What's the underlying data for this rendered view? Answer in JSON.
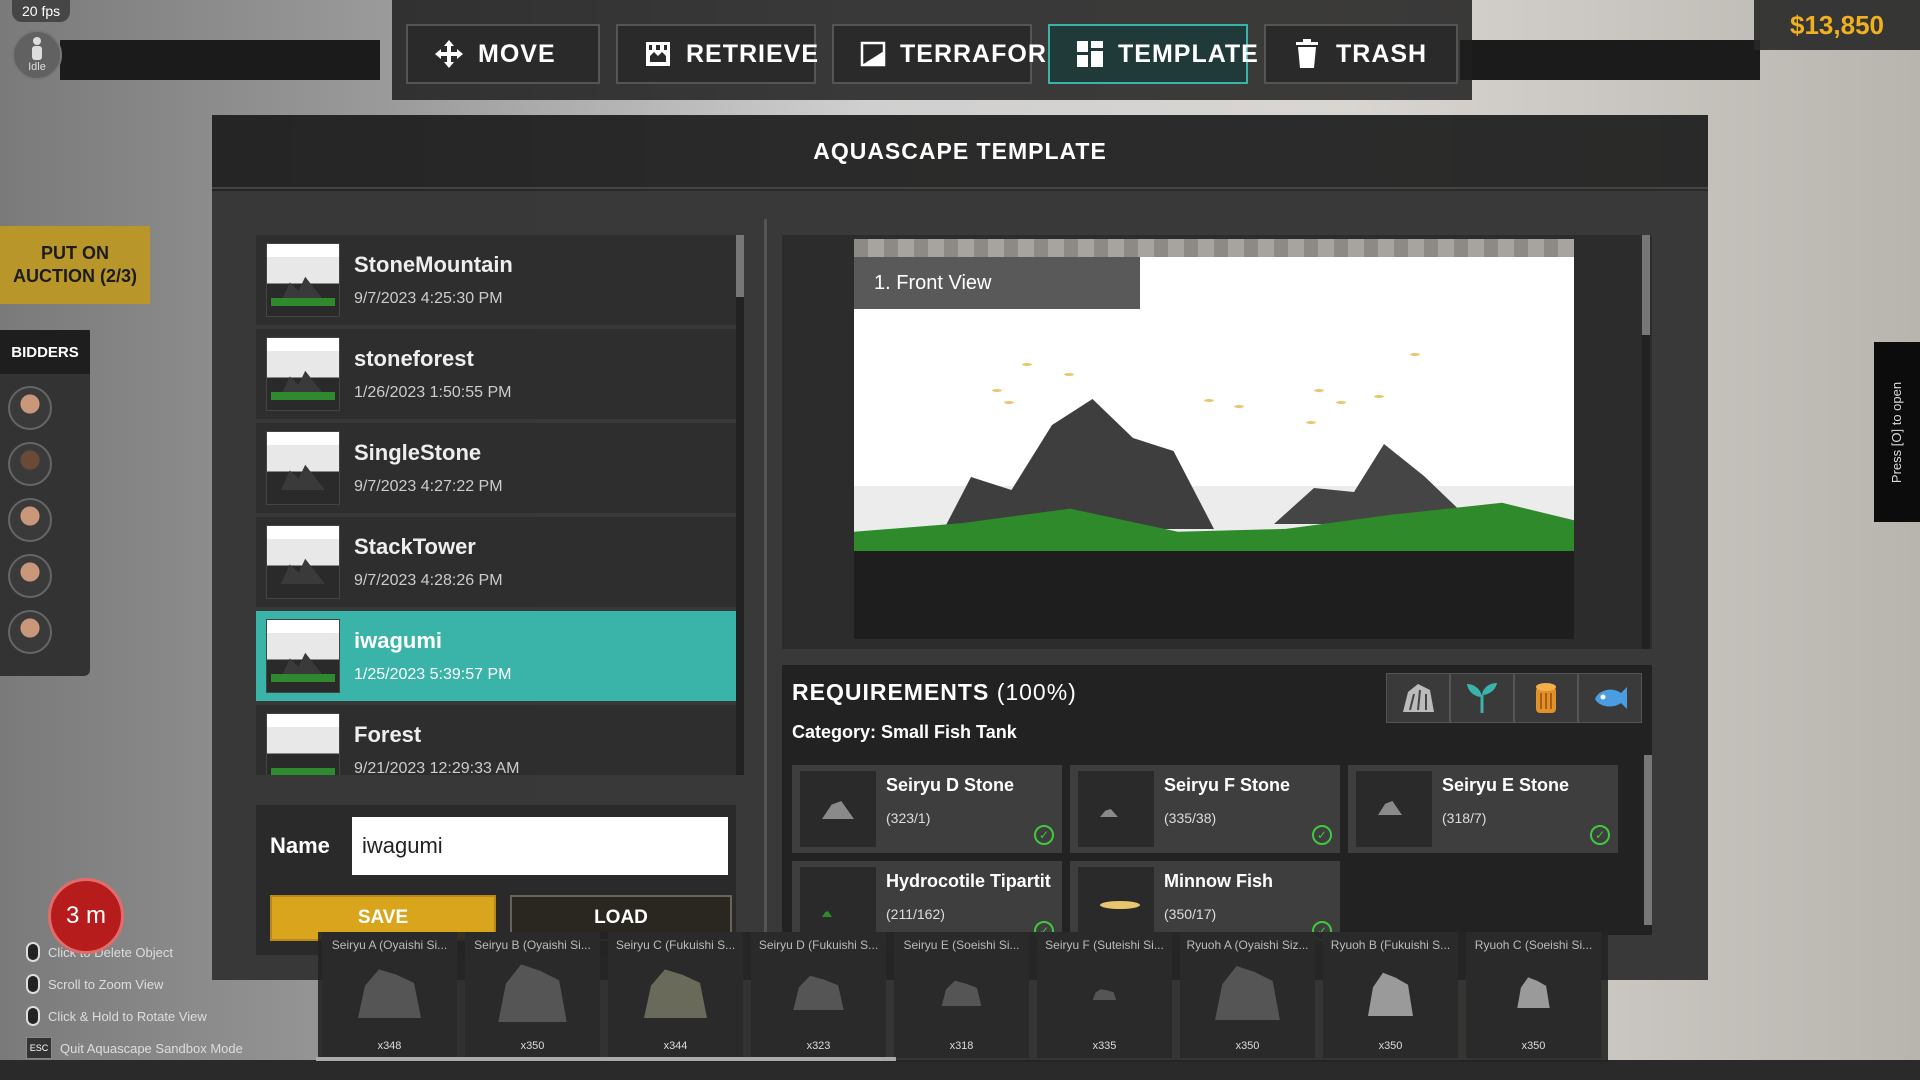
{
  "hud": {
    "fps": "20 fps",
    "status": "Idle",
    "money": "$13,850",
    "range": "3 m",
    "side_tab": "Press [O] to open"
  },
  "toolbar": {
    "move": "MOVE",
    "retrieve": "RETRIEVE",
    "terraform": "TERRAFORM",
    "template": "TEMPLATE",
    "trash": "TRASH",
    "active": "TEMPLATE"
  },
  "auction": {
    "label": "PUT ON AUCTION (2/3)",
    "bidders_title": "BIDDERS"
  },
  "panel": {
    "title": "AQUASCAPE TEMPLATE"
  },
  "templates": [
    {
      "name": "StoneMountain",
      "date": "9/7/2023 4:25:30 PM"
    },
    {
      "name": "stoneforest",
      "date": "1/26/2023 1:50:55 PM"
    },
    {
      "name": "SingleStone",
      "date": "9/7/2023 4:27:22 PM"
    },
    {
      "name": "StackTower",
      "date": "9/7/2023 4:28:26 PM"
    },
    {
      "name": "iwagumi",
      "date": "1/25/2023 5:39:57 PM"
    },
    {
      "name": "Forest",
      "date": "9/21/2023 12:29:33 AM"
    }
  ],
  "selected_template": "iwagumi",
  "name_field": {
    "label": "Name",
    "value": "iwagumi"
  },
  "buttons": {
    "save": "SAVE",
    "load": "LOAD"
  },
  "preview": {
    "view_label": "1. Front View"
  },
  "requirements": {
    "title": "REQUIREMENTS",
    "percent": "(100%)",
    "category": "Category: Small Fish Tank",
    "icons": [
      "stone-icon",
      "plant-icon",
      "wood-icon",
      "fish-icon"
    ],
    "items": [
      {
        "name": "Seiryu D Stone",
        "count": "(323/1)"
      },
      {
        "name": "Seiryu F Stone",
        "count": "(335/38)"
      },
      {
        "name": "Seiryu E Stone",
        "count": "(318/7)"
      },
      {
        "name": "Hydrocotile Tipartit",
        "count": "(211/162)"
      },
      {
        "name": "Minnow Fish",
        "count": "(350/17)"
      }
    ]
  },
  "inventory": [
    {
      "name": "Seiryu A (Oyaishi Si...",
      "count": "x348"
    },
    {
      "name": "Seiryu B (Oyaishi Si...",
      "count": "x350"
    },
    {
      "name": "Seiryu C (Fukuishi S...",
      "count": "x344"
    },
    {
      "name": "Seiryu D (Fukuishi S...",
      "count": "x323"
    },
    {
      "name": "Seiryu E (Soeishi Si...",
      "count": "x318"
    },
    {
      "name": "Seiryu F (Suteishi Si...",
      "count": "x335"
    },
    {
      "name": "Ryuoh A (Oyaishi Siz...",
      "count": "x350"
    },
    {
      "name": "Ryuoh B (Fukuishi S...",
      "count": "x350"
    },
    {
      "name": "Ryuoh C (Soeishi Si...",
      "count": "x350"
    }
  ],
  "hints": [
    "Click to Delete Object",
    "Scroll to Zoom View",
    "Click & Hold to Rotate View",
    "Quit Aquascape Sandbox Mode"
  ],
  "hint_esc_key": "ESC",
  "colors": {
    "accent": "#3ab3a8",
    "save": "#d9a51c",
    "money": "#f0b020",
    "auction": "#b8962a",
    "check": "#3fc93f"
  }
}
